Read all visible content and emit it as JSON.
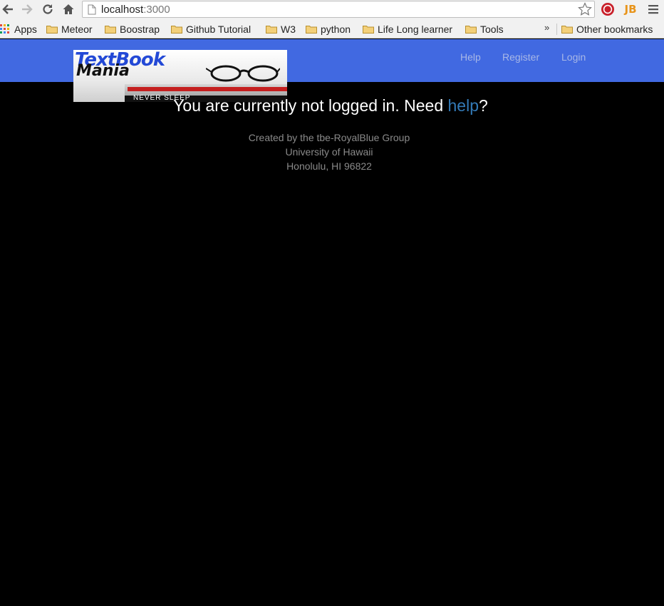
{
  "browser": {
    "url_host": "localhost",
    "url_port": ":3000",
    "bookmarks": {
      "apps": "Apps",
      "items": [
        "Meteor",
        "Boostrap",
        "Github Tutorial",
        "W3",
        "python",
        "Life Long learner",
        "Tools"
      ],
      "overflow": "»",
      "other": "Other bookmarks"
    },
    "extension_label": "JB"
  },
  "navbar": {
    "links": [
      "Help",
      "Register",
      "Login"
    ],
    "background": "#4169e1"
  },
  "logo": {
    "line1": "TextBook",
    "line2": "Mania",
    "tagline": "NEVER SLEEP"
  },
  "main": {
    "message_prefix": "You are currently not logged in. Need ",
    "help_link": "help",
    "message_suffix": "?"
  },
  "footer": {
    "line1": "Created by the tbe-RoyalBlue Group",
    "line2": "University of Hawaii",
    "line3": "Honolulu, HI 96822"
  }
}
